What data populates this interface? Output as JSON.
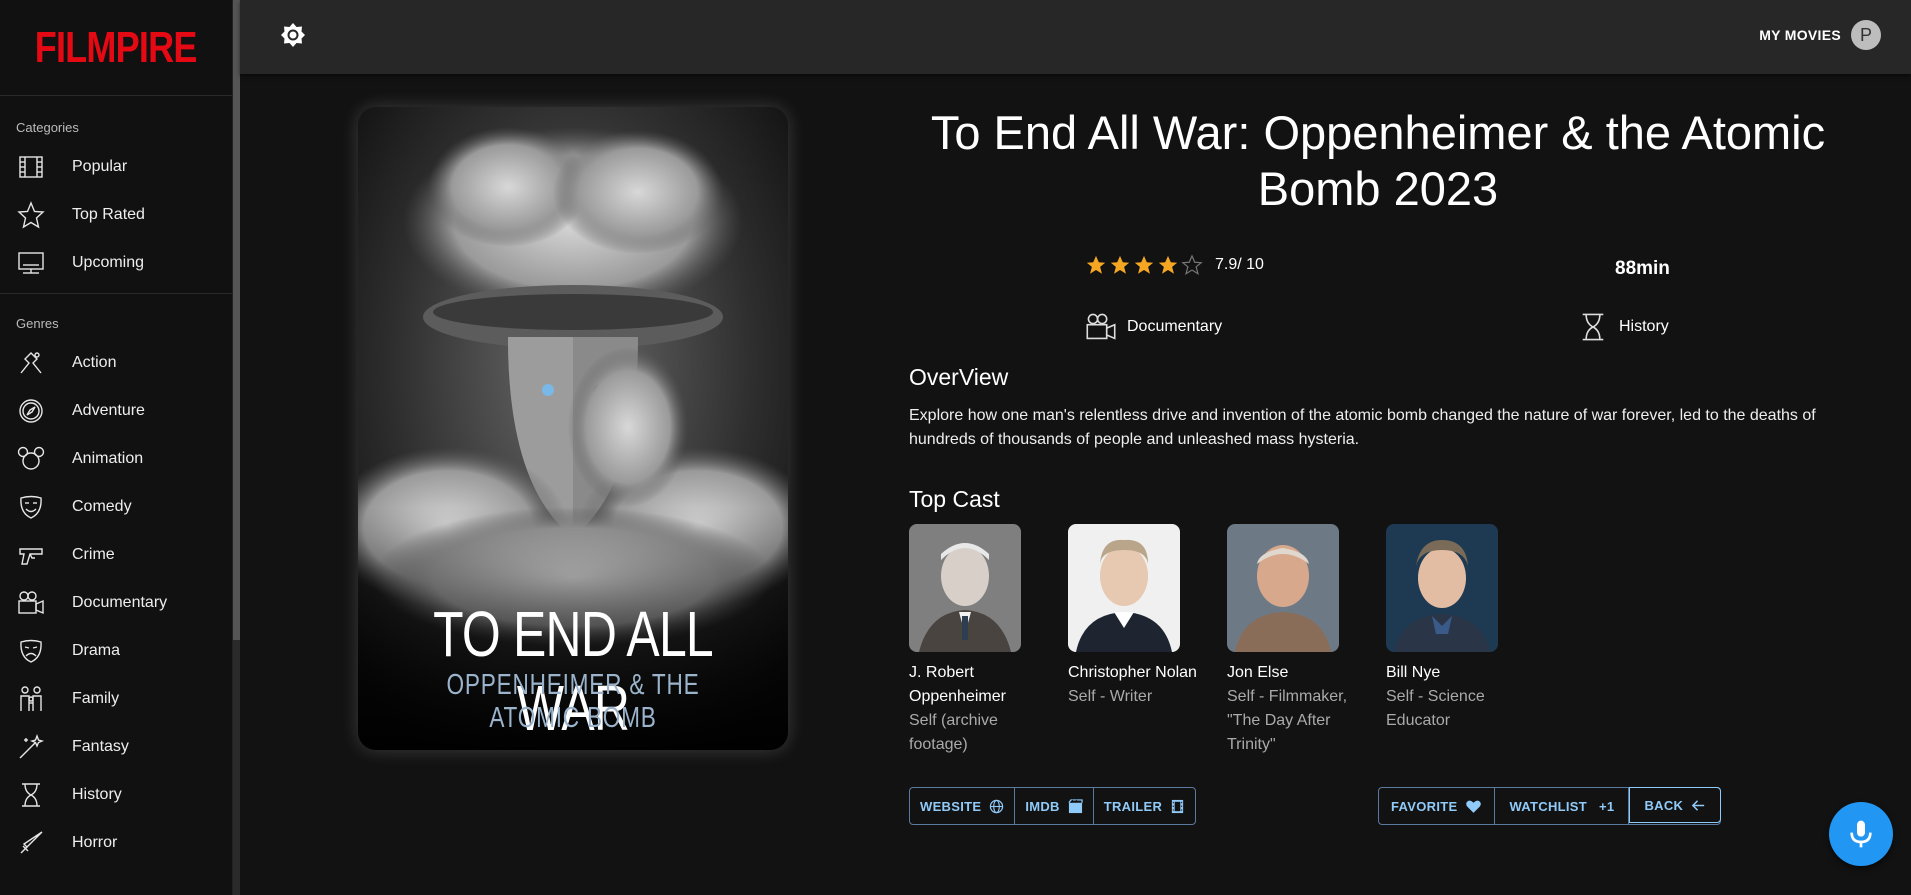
{
  "app": {
    "logo": "FILMPIRE"
  },
  "header": {
    "my_movies": "MY MOVIES",
    "avatar_letter": "P"
  },
  "sidebar": {
    "categories_title": "Categories",
    "categories": [
      {
        "label": "Popular",
        "icon": "film-icon"
      },
      {
        "label": "Top Rated",
        "icon": "star-icon"
      },
      {
        "label": "Upcoming",
        "icon": "screen-icon"
      }
    ],
    "genres_title": "Genres",
    "genres": [
      {
        "label": "Action",
        "icon": "action-icon"
      },
      {
        "label": "Adventure",
        "icon": "compass-icon"
      },
      {
        "label": "Animation",
        "icon": "mouse-ears-icon"
      },
      {
        "label": "Comedy",
        "icon": "comedy-mask-icon"
      },
      {
        "label": "Crime",
        "icon": "gun-icon"
      },
      {
        "label": "Documentary",
        "icon": "camera-icon"
      },
      {
        "label": "Drama",
        "icon": "drama-mask-icon"
      },
      {
        "label": "Family",
        "icon": "family-icon"
      },
      {
        "label": "Fantasy",
        "icon": "magic-wand-icon"
      },
      {
        "label": "History",
        "icon": "hourglass-icon"
      },
      {
        "label": "Horror",
        "icon": "knife-icon"
      }
    ]
  },
  "movie": {
    "title": "To End All War: Oppenheimer & the Atomic Bomb 2023",
    "poster_title": "TO END ALL WAR",
    "poster_subtitle": "OPPENHEIMER & THE ATOMIC BOMB",
    "rating_text": "7.9/ 10",
    "rating_stars": 4,
    "rating_max": 5,
    "runtime": "88min",
    "genres": [
      "Documentary",
      "History"
    ],
    "overview_heading": "OverView",
    "overview": "Explore how one man's relentless drive and invention of the atomic bomb changed the nature of war forever, led to the deaths of hundreds of thousands of people and unleashed mass hysteria.",
    "cast_heading": "Top Cast",
    "cast": [
      {
        "name": "J. Robert Oppenheimer",
        "role": "Self (archive footage)"
      },
      {
        "name": "Christopher Nolan",
        "role": "Self - Writer"
      },
      {
        "name": "Jon Else",
        "role": "Self - Filmmaker, \"The Day After Trinity\""
      },
      {
        "name": "Bill Nye",
        "role": "Self - Science Educator"
      }
    ]
  },
  "links": {
    "website": "WEBSITE",
    "imdb": "IMDB",
    "trailer": "TRAILER"
  },
  "actions": {
    "favorite": "FAVORITE",
    "watchlist": "WATCHLIST",
    "watchlist_badge": "+1",
    "back": "BACK"
  },
  "colors": {
    "brand": "#e50914",
    "accent": "#90caf9",
    "star": "#f5a623",
    "mic": "#2196f3"
  }
}
